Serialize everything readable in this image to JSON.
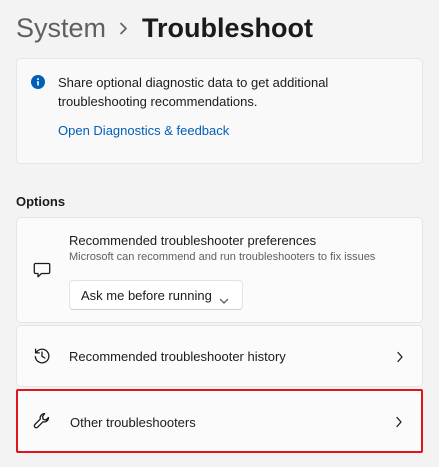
{
  "header": {
    "parent": "System",
    "current": "Troubleshoot"
  },
  "info": {
    "message": "Share optional diagnostic data to get additional troubleshooting recommendations.",
    "link": "Open Diagnostics & feedback",
    "icon": "info-icon",
    "accent": "#005fb8"
  },
  "options": {
    "label": "Options",
    "preferences": {
      "title": "Recommended troubleshooter preferences",
      "description": "Microsoft can recommend and run troubleshooters to fix issues",
      "dropdown_value": "Ask me before running",
      "icon": "chat-bubble-icon"
    },
    "history": {
      "label": "Recommended troubleshooter history",
      "icon": "history-icon"
    },
    "other": {
      "label": "Other troubleshooters",
      "icon": "wrench-icon",
      "highlight_color": "#e1141b"
    }
  }
}
